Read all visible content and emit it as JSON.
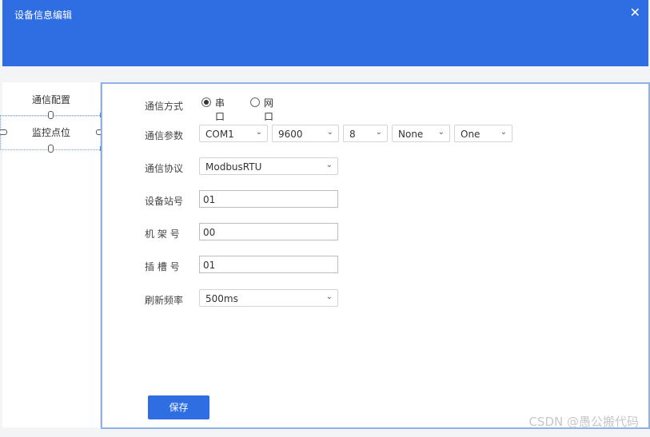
{
  "dialog": {
    "title": "设备信息编辑",
    "close_glyph": "✕"
  },
  "sidebar": {
    "items": [
      {
        "label": "通信配置"
      },
      {
        "label": "监控点位"
      }
    ]
  },
  "form": {
    "comm_mode": {
      "label": "通信方式",
      "options": [
        {
          "label": "串口",
          "selected": true
        },
        {
          "label": "网口",
          "selected": false
        }
      ]
    },
    "comm_params": {
      "label": "通信参数",
      "port": "COM1",
      "baud": "9600",
      "data_bits": "8",
      "parity": "None",
      "stop_bits": "One"
    },
    "protocol": {
      "label": "通信协议",
      "value": "ModbusRTU"
    },
    "station": {
      "label": "设备站号",
      "value": "01"
    },
    "rack": {
      "label": "机 架 号",
      "value": "00"
    },
    "slot": {
      "label": "插 槽 号",
      "value": "01"
    },
    "refresh": {
      "label": "刷新频率",
      "value": "500ms"
    },
    "save_label": "保存"
  },
  "chevron_glyph": "⌄",
  "watermark": "CSDN @愚公搬代码",
  "colors": {
    "primary": "#2e6de2",
    "header_text": "#ffffff"
  }
}
